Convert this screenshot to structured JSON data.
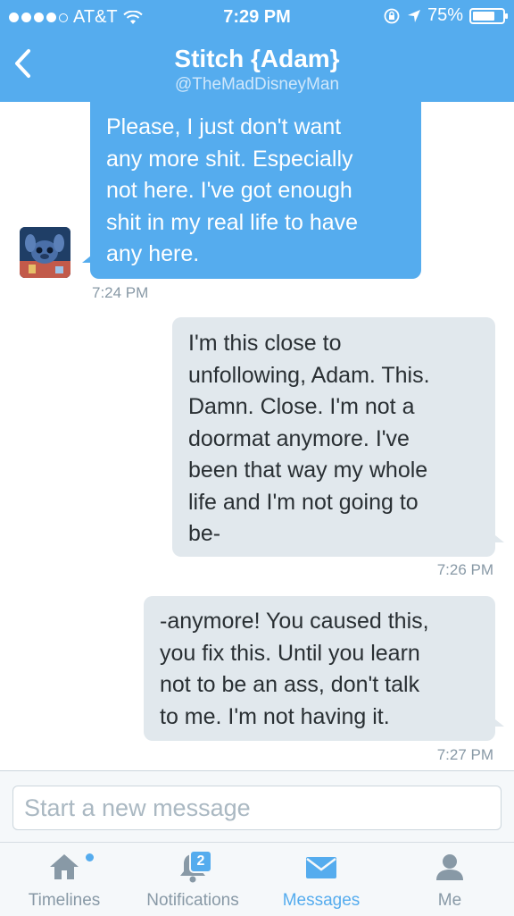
{
  "status_bar": {
    "carrier": "AT&T",
    "signal_bars": 4,
    "time": "7:29 PM",
    "battery_percent": "75%",
    "battery_level": 0.75
  },
  "header": {
    "title": "Stitch {Adam}",
    "handle": "@TheMadDisneyMan",
    "back_icon": "chevron-left-icon"
  },
  "messages": [
    {
      "direction": "incoming",
      "lines": [
        "Please, I just don't want",
        "any more shit. Especially",
        "not here. I've got enough",
        "shit in my real life to have",
        "any here."
      ],
      "time": "7:24 PM"
    },
    {
      "direction": "outgoing",
      "lines": [
        "I'm this close to",
        "unfollowing, Adam. This.",
        "Damn. Close. I'm not a",
        "doormat anymore. I've",
        "been that way my whole",
        "life and I'm not going to",
        "be-"
      ],
      "time": "7:26 PM"
    },
    {
      "direction": "outgoing",
      "lines": [
        "-anymore! You caused this,",
        "you fix this. Until you learn",
        "not to be an ass, don't talk",
        "to me. I'm not having it."
      ],
      "time": "7:27 PM"
    }
  ],
  "composer": {
    "placeholder": "Start a new message"
  },
  "tabbar": {
    "tabs": [
      {
        "label": "Timelines",
        "icon": "home-icon",
        "active": false,
        "has_new_dot": true
      },
      {
        "label": "Notifications",
        "icon": "bell-icon",
        "active": false,
        "badge": "2"
      },
      {
        "label": "Messages",
        "icon": "envelope-icon",
        "active": true
      },
      {
        "label": "Me",
        "icon": "person-icon",
        "active": false
      }
    ]
  },
  "colors": {
    "accent": "#55acee",
    "incoming_bubble": "#55acee",
    "outgoing_bubble": "#e1e8ed",
    "timestamp": "#8899a6",
    "tab_inactive": "#8899a6"
  }
}
